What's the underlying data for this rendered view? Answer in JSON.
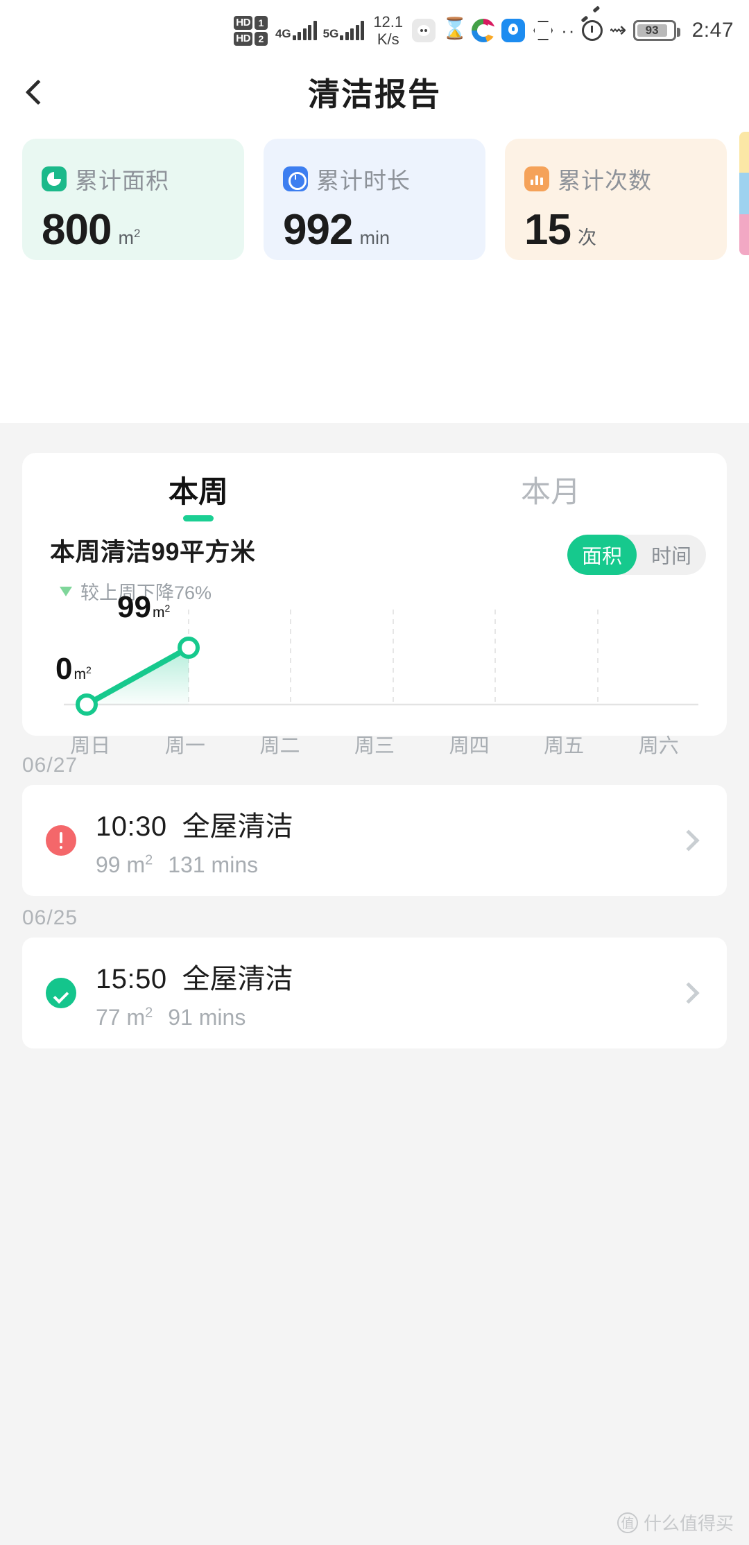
{
  "status_bar": {
    "hd_labels": [
      "HD",
      "HD"
    ],
    "sim_labels": [
      "1",
      "2"
    ],
    "net1": "4G",
    "net2": "5G",
    "speed_value": "12.1",
    "speed_unit": "K/s",
    "battery": "93",
    "time": "2:47"
  },
  "nav": {
    "title": "清洁报告",
    "back_icon": "chevron-left-icon"
  },
  "stats": [
    {
      "label": "累计面积",
      "value": "800",
      "unit": "m",
      "sup": "2",
      "icon": "pie-chart-icon",
      "accent": "#1bb98a",
      "bg": "#e9f8f2"
    },
    {
      "label": "累计时长",
      "value": "992",
      "unit": "min",
      "sup": "",
      "icon": "clock-icon",
      "accent": "#3d7ef0",
      "bg": "#edf3fd"
    },
    {
      "label": "累计次数",
      "value": "15",
      "unit": "次",
      "sup": "",
      "icon": "bar-chart-icon",
      "accent": "#f5a259",
      "bg": "#fdf2e5"
    }
  ],
  "chart_panel": {
    "tabs": [
      {
        "label": "本周",
        "active": true
      },
      {
        "label": "本月",
        "active": false
      }
    ],
    "summary_title": "本周清洁99平方米",
    "summary_sub": "较上周下降76%",
    "trend_icon": "arrow-down-icon",
    "segments": [
      {
        "label": "面积",
        "active": true
      },
      {
        "label": "时间",
        "active": false
      }
    ]
  },
  "chart_data": {
    "type": "line",
    "title": "本周清洁99平方米",
    "categories": [
      "周日",
      "周一",
      "周二",
      "周三",
      "周四",
      "周五",
      "周六"
    ],
    "values": [
      0,
      99,
      null,
      null,
      null,
      null,
      null
    ],
    "point_labels": [
      "0",
      "99"
    ],
    "unit": "m²",
    "xlabel": "",
    "ylabel": "",
    "ylim": [
      0,
      130
    ],
    "grid": "vertical-dashed",
    "legend": "none",
    "line_color": "#16c98d",
    "area_fill": "#16c98d"
  },
  "history": [
    {
      "date": "06/27",
      "status": "alert",
      "time": "10:30",
      "mode": "全屋清洁",
      "area": "99 m",
      "area_sup": "2",
      "duration": "131 mins",
      "chevron": "chevron-right-icon"
    },
    {
      "date": "06/25",
      "status": "ok",
      "time": "15:50",
      "mode": "全屋清洁",
      "area": "77 m",
      "area_sup": "2",
      "duration": "91 mins",
      "chevron": "chevron-right-icon"
    }
  ],
  "watermark": {
    "logo": "值",
    "text": "什么值得买"
  }
}
